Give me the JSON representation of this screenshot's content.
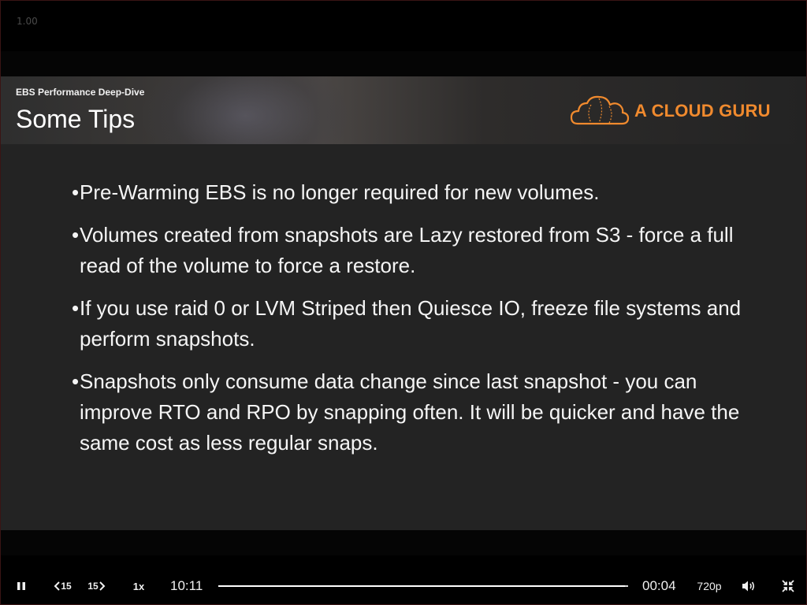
{
  "player": {
    "speed_readout": "1.00",
    "controls": {
      "skip_back_label": "15",
      "skip_forward_label": "15",
      "speed_label": "1x",
      "elapsed_time": "10:11",
      "remaining_time": "00:04",
      "quality_label": "720p",
      "progress_fraction": 0.993
    },
    "icons": {
      "play_pause": "pause-icon",
      "skip_back": "rewind-15-icon",
      "skip_forward": "forward-15-icon",
      "volume": "volume-icon",
      "fullscreen": "exit-fullscreen-icon"
    }
  },
  "slide": {
    "course_name": "EBS Performance Deep-Dive",
    "title": "Some Tips",
    "brand_name": "A CLOUD GURU",
    "bullet_marker": "•",
    "bullets": [
      {
        "text": "Pre-Warming EBS is no longer required for new volumes."
      },
      {
        "text": " Volumes created from snapshots are Lazy restored from S3 - force a full read of the volume to force a restore."
      },
      {
        "text": " If you use raid 0 or LVM Striped then Quiesce IO, freeze file systems and perform snapshots."
      },
      {
        "text": " Snapshots only consume data change since last snapshot - you can improve RTO and RPO by snapping often. It will be quicker and have the same cost as less regular snaps."
      }
    ]
  },
  "colors": {
    "brand_orange": "#f08a2e",
    "slide_background": "#232323",
    "player_background": "#000000"
  }
}
